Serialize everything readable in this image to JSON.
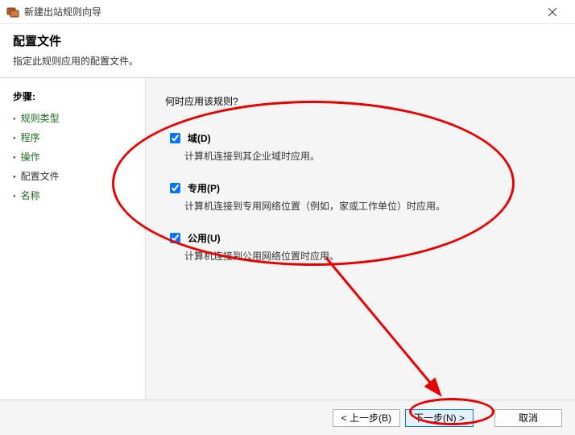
{
  "window": {
    "title": "新建出站规则向导"
  },
  "header": {
    "title": "配置文件",
    "subtitle": "指定此规则应用的配置文件。"
  },
  "sidebar": {
    "title": "步骤:",
    "items": [
      {
        "label": "规则类型"
      },
      {
        "label": "程序"
      },
      {
        "label": "操作"
      },
      {
        "label": "配置文件"
      },
      {
        "label": "名称"
      }
    ]
  },
  "content": {
    "question": "何时应用该规则?",
    "options": [
      {
        "label": "域(D)",
        "desc": "计算机连接到其企业域时应用。",
        "checked": true
      },
      {
        "label": "专用(P)",
        "desc": "计算机连接到专用网络位置（例如，家或工作单位）时应用。",
        "checked": true
      },
      {
        "label": "公用(U)",
        "desc": "计算机连接到公用网络位置时应用。",
        "checked": true
      }
    ]
  },
  "footer": {
    "back": "< 上一步(B)",
    "next": "下一步(N) >",
    "cancel": "取消"
  }
}
